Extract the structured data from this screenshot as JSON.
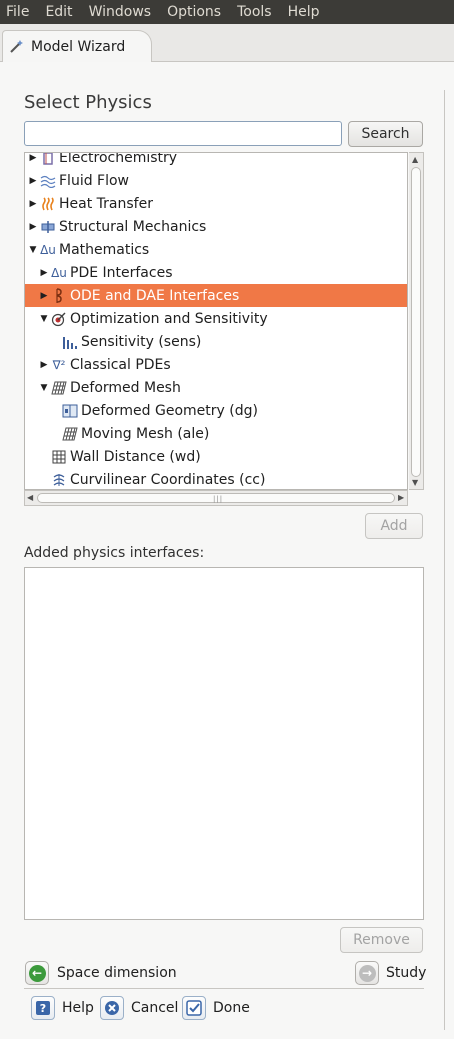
{
  "menubar": {
    "items": [
      "File",
      "Edit",
      "Windows",
      "Options",
      "Tools",
      "Help"
    ]
  },
  "tab": {
    "label": "Model Wizard"
  },
  "heading": "Select Physics",
  "search": {
    "value": "",
    "button_label": "Search"
  },
  "tree": {
    "rows": [
      {
        "label": "Electrochemistry",
        "icon": "electrochemistry-icon",
        "expanded": false,
        "selected": false
      },
      {
        "label": "Fluid Flow",
        "icon": "fluid-flow-icon",
        "expanded": false,
        "selected": false
      },
      {
        "label": "Heat Transfer",
        "icon": "heat-transfer-icon",
        "expanded": false,
        "selected": false
      },
      {
        "label": "Structural Mechanics",
        "icon": "structural-mechanics-icon",
        "expanded": false,
        "selected": false
      },
      {
        "label": "Mathematics",
        "icon": "mathematics-icon",
        "expanded": true,
        "selected": false
      },
      {
        "label": "PDE Interfaces",
        "icon": "pde-interfaces-icon",
        "expanded": false,
        "selected": false
      },
      {
        "label": "ODE and DAE Interfaces",
        "icon": "ode-dae-icon",
        "expanded": false,
        "selected": true
      },
      {
        "label": "Optimization and Sensitivity",
        "icon": "optimization-icon",
        "expanded": true,
        "selected": false
      },
      {
        "label": "Sensitivity (sens)",
        "icon": "sensitivity-icon",
        "expanded": null,
        "selected": false
      },
      {
        "label": "Classical PDEs",
        "icon": "classical-pdes-icon",
        "expanded": false,
        "selected": false
      },
      {
        "label": "Deformed Mesh",
        "icon": "deformed-mesh-icon",
        "expanded": true,
        "selected": false
      },
      {
        "label": "Deformed Geometry (dg)",
        "icon": "deformed-geometry-icon",
        "expanded": null,
        "selected": false
      },
      {
        "label": "Moving Mesh (ale)",
        "icon": "moving-mesh-icon",
        "expanded": null,
        "selected": false
      },
      {
        "label": "Wall Distance (wd)",
        "icon": "wall-distance-icon",
        "expanded": null,
        "selected": false
      },
      {
        "label": "Curvilinear Coordinates (cc)",
        "icon": "curvilinear-coordinates-icon",
        "expanded": null,
        "selected": false
      }
    ]
  },
  "add_button": "Add",
  "added_label": "Added physics interfaces:",
  "added_items": [],
  "remove_button": "Remove",
  "nav": {
    "back_label": "Space dimension",
    "next_label": "Study"
  },
  "footer": {
    "help": "Help",
    "cancel": "Cancel",
    "done": "Done"
  },
  "colors": {
    "selection": "#f07846",
    "menubar": "#3c3b37"
  }
}
